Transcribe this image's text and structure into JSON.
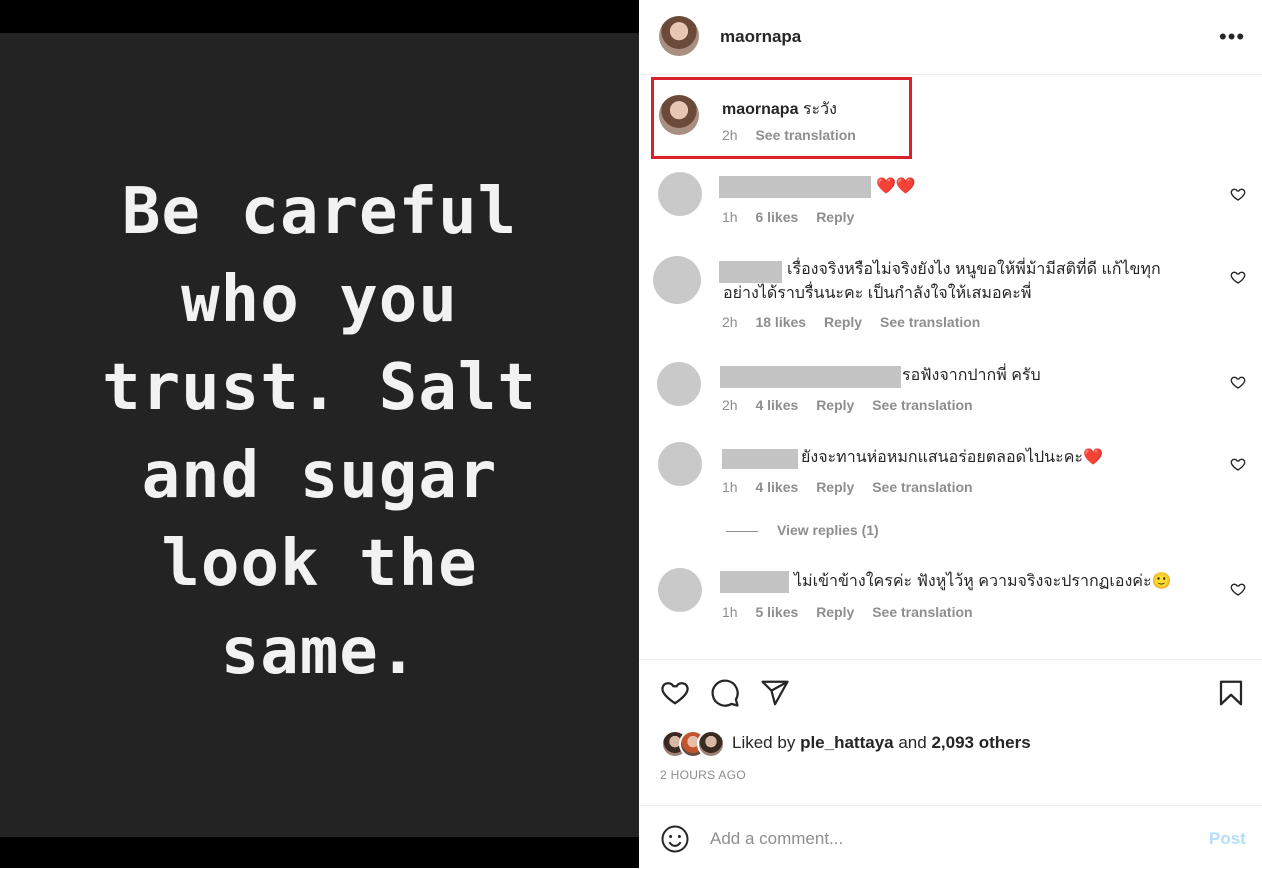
{
  "post": {
    "quote": "Be careful\nwho you\ntrust. Salt\nand sugar\nlook the\nsame."
  },
  "header": {
    "username": "maornapa",
    "more_label": "•••"
  },
  "caption": {
    "username": "maornapa",
    "text": "ระวัง",
    "time": "2h",
    "translate": "See translation"
  },
  "comments": [
    {
      "text": "❤️❤️",
      "time": "1h",
      "likes": "6 likes",
      "reply": "Reply",
      "translate": ""
    },
    {
      "text": "เรื่องจริงหรือไม่จริงยังไง หนูขอให้พี่ม้ามีสติที่ดี แก้ไขทุกอย่างได้ราบรื่นนะคะ เป็นกำลังใจให้เสมอคะพี่",
      "time": "2h",
      "likes": "18 likes",
      "reply": "Reply",
      "translate": "See translation"
    },
    {
      "text": "รอฟังจากปากพี่ ครับ",
      "time": "2h",
      "likes": "4 likes",
      "reply": "Reply",
      "translate": "See translation"
    },
    {
      "text": "ยังจะทานห่อหมกแสนอร่อยตลอดไปนะคะ❤️",
      "time": "1h",
      "likes": "4 likes",
      "reply": "Reply",
      "translate": "See translation",
      "view_replies": "View replies (1)"
    },
    {
      "text": "ไม่เข้าข้างใครค่ะ ฟังหูไว้หู ความจริงจะปรากฏเองค่ะ🙂",
      "time": "1h",
      "likes": "5 likes",
      "reply": "Reply",
      "translate": "See translation"
    }
  ],
  "likes": {
    "prefix": "Liked by",
    "user": "ple_hattaya",
    "and": "and",
    "others": "2,093 others"
  },
  "timestamp": "2 HOURS AGO",
  "comment_input": {
    "placeholder": "Add a comment...",
    "post_label": "Post"
  },
  "colors": {
    "redact": "#c4c4c4",
    "highlight_box": "#d9202c",
    "post_button": "#b2dffc"
  }
}
